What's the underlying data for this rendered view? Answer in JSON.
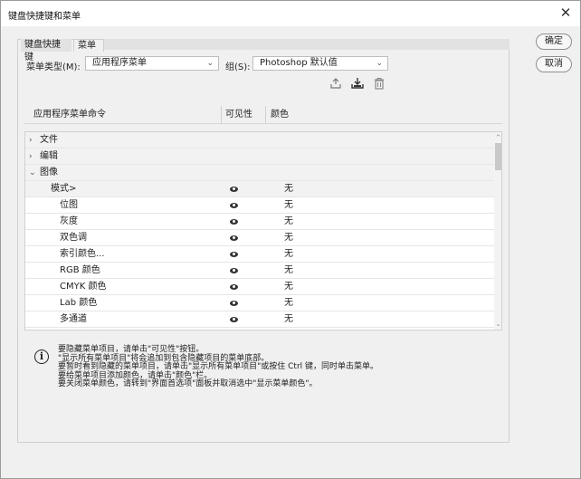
{
  "window": {
    "title": "键盘快捷键和菜单"
  },
  "tabs": [
    {
      "label": "键盘快捷键"
    },
    {
      "label": "菜单"
    }
  ],
  "menu_type": {
    "label": "菜单类型(M):",
    "value": "应用程序菜单"
  },
  "set": {
    "label": "组(S):",
    "value": "Photoshop 默认值"
  },
  "buttons": {
    "ok": "确定",
    "cancel": "取消"
  },
  "columns": {
    "command": "应用程序菜单命令",
    "visibility": "可见性",
    "color": "颜色"
  },
  "rows": [
    {
      "label": "文件",
      "expander": "›",
      "group": true
    },
    {
      "label": "编辑",
      "expander": "›",
      "group": true
    },
    {
      "label": "图像",
      "expander": "⌄",
      "group": true
    },
    {
      "label": "模式>",
      "color": "无",
      "visible": true
    },
    {
      "label": "位图",
      "color": "无",
      "visible": true
    },
    {
      "label": "灰度",
      "color": "无",
      "visible": true
    },
    {
      "label": "双色调",
      "color": "无",
      "visible": true
    },
    {
      "label": "索引颜色...",
      "color": "无",
      "visible": true
    },
    {
      "label": "RGB 颜色",
      "color": "无",
      "visible": true
    },
    {
      "label": "CMYK 颜色",
      "color": "无",
      "visible": true
    },
    {
      "label": "Lab 颜色",
      "color": "无",
      "visible": true
    },
    {
      "label": "多通道",
      "color": "无",
      "visible": true
    }
  ],
  "info_lines": [
    "要隐藏菜单项目，请单击\"可见性\"按钮。",
    "\"显示所有菜单项目\"将会追加到包含隐藏项目的菜单底部。",
    "要暂时看到隐藏的菜单项目，请单击\"显示所有菜单项目\"或按住 Ctrl 键，同时单击菜单。",
    "要给菜单项目添加颜色，请单击\"颜色\"栏。",
    "要关闭菜单颜色，请转到\"界面首选项\"面板并取消选中\"显示菜单颜色\"。"
  ],
  "icons": {
    "save_set": "save-set-icon",
    "new_set": "new-set-icon",
    "delete_set": "delete-set-icon",
    "info": "info-icon",
    "visibility": "eye-icon"
  }
}
